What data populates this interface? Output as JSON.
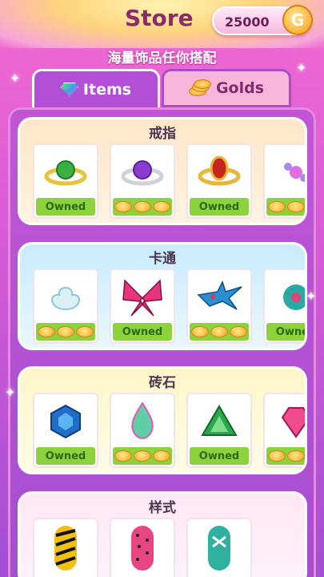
{
  "header": {
    "title": "Store",
    "coins": "25000",
    "coin_icon": "G"
  },
  "subtitle": "海量饰品任你搭配",
  "tabs": [
    {
      "label": "Items",
      "icon": "gem-icon",
      "active": true
    },
    {
      "label": "Golds",
      "icon": "coins-icon",
      "active": false
    }
  ],
  "sections": [
    {
      "title": "戒指",
      "items": [
        {
          "art": "green-ring",
          "status": "Owned"
        },
        {
          "art": "purple-ring",
          "status": "price"
        },
        {
          "art": "red-ring",
          "status": "Owned"
        },
        {
          "art": "pink-ring",
          "status": "price"
        }
      ]
    },
    {
      "title": "卡通",
      "items": [
        {
          "art": "flower-outline",
          "status": "price"
        },
        {
          "art": "pink-butterfly",
          "status": "Owned"
        },
        {
          "art": "blue-bird",
          "status": "price"
        },
        {
          "art": "teal-flower",
          "status": "Owned"
        }
      ]
    },
    {
      "title": "砖石",
      "items": [
        {
          "art": "blue-gem",
          "status": "Owned"
        },
        {
          "art": "teardrop-gem",
          "status": "price"
        },
        {
          "art": "green-triangle-gem",
          "status": "Owned"
        },
        {
          "art": "pink-gem",
          "status": "price"
        }
      ]
    },
    {
      "title": "样式",
      "items": [
        {
          "art": "zebra-nail",
          "status": ""
        },
        {
          "art": "polka-nail",
          "status": ""
        },
        {
          "art": "cross-nail",
          "status": ""
        }
      ]
    }
  ],
  "owned_label": "Owned"
}
